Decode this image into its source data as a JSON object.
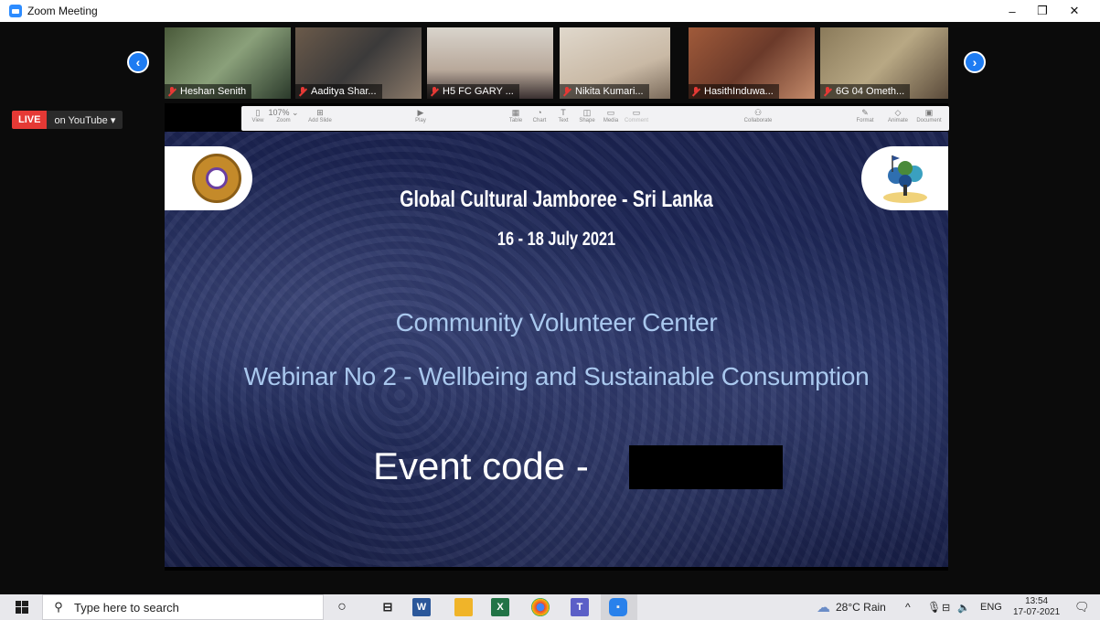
{
  "window": {
    "title": "Zoom Meeting"
  },
  "window_controls": {
    "minimize": "–",
    "restore": "❐",
    "close": "✕"
  },
  "participants": [
    {
      "name": "Heshan Senith"
    },
    {
      "name": "Aaditya Shar..."
    },
    {
      "name": "H5 FC GARY ..."
    },
    {
      "name": "Nikita Kumari..."
    },
    {
      "name": "HasithInduwa..."
    },
    {
      "name": "6G 04 Ometh..."
    }
  ],
  "nav": {
    "prev": "‹",
    "next": "›"
  },
  "live": {
    "badge": "LIVE",
    "target": "on YouTube ▾"
  },
  "keynote_toolbar": [
    {
      "icon": "▯",
      "label": "View"
    },
    {
      "icon": "107% ⌄",
      "label": "Zoom"
    },
    {
      "icon": "⊞",
      "label": "Add Slide"
    },
    {
      "icon": "▶",
      "label": "Play"
    },
    {
      "icon": "▦",
      "label": "Table"
    },
    {
      "icon": "◔",
      "label": "Chart"
    },
    {
      "icon": "T",
      "label": "Text"
    },
    {
      "icon": "◫",
      "label": "Shape"
    },
    {
      "icon": "▭",
      "label": "Media"
    },
    {
      "icon": "▭",
      "label": "Comment"
    },
    {
      "icon": "⚇",
      "label": "Collaborate"
    },
    {
      "icon": "✎",
      "label": "Format"
    },
    {
      "icon": "◇",
      "label": "Animate"
    },
    {
      "icon": "▣",
      "label": "Document"
    }
  ],
  "slide": {
    "title": "Global Cultural Jamboree - Sri Lanka",
    "dates": "16 - 18 July 2021",
    "center": "Community Volunteer Center",
    "webinar": "Webinar No 2 - Wellbeing and Sustainable Consumption",
    "event_code_label": "Event code -"
  },
  "taskbar": {
    "search_placeholder": "Type here to search",
    "weather": "28°C  Rain",
    "lang": "ENG",
    "time": "13:54",
    "date": "17-07-2021"
  }
}
